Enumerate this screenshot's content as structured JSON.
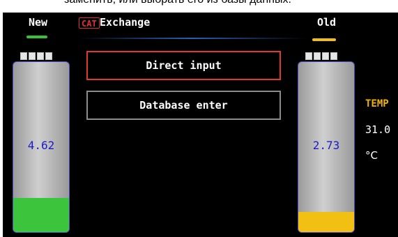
{
  "caption": "заменить, или выбрать его из базы данных.",
  "header": {
    "new_label": "New",
    "cat_badge": "CAT",
    "title": "Exchange",
    "old_label": "Old"
  },
  "menu": {
    "direct_input": "Direct input",
    "database_enter": "Database enter"
  },
  "batteries": {
    "new": {
      "value": "4.62",
      "level": 0.2,
      "fill_color": "#3cc43c",
      "indicator_color": "#35c435"
    },
    "old": {
      "value": "2.73",
      "level": 0.12,
      "fill_color": "#f2c012",
      "indicator_color": "#f2c012"
    }
  },
  "temperature": {
    "label": "TEMP",
    "value": "31.0",
    "unit": "°C"
  },
  "colors": {
    "selected_border": "#e03a2e",
    "unselected_border": "#8c8c8c",
    "temp_label": "#f0b400"
  }
}
